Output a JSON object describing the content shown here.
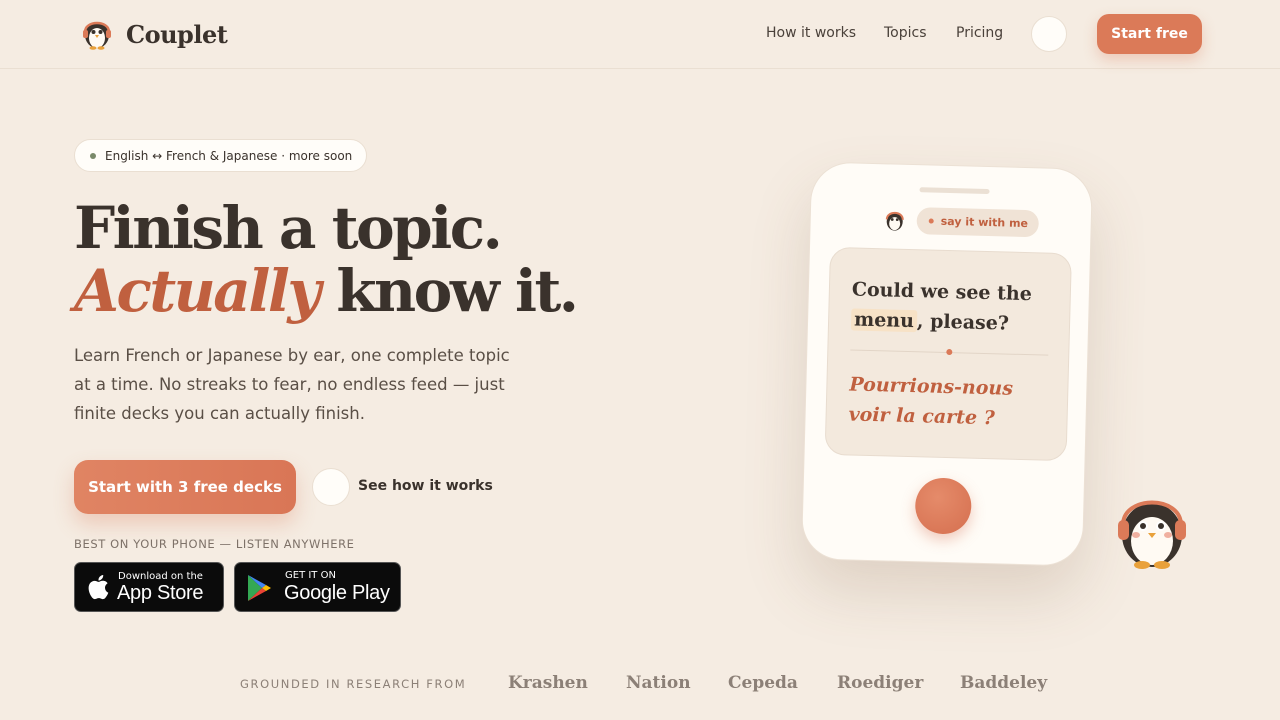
{
  "nav": {
    "brand": "Couplet",
    "links": [
      "How it works",
      "Topics",
      "Pricing"
    ],
    "cta": "Start free"
  },
  "hero": {
    "badge": "English ↔ French & Japanese · more soon",
    "title_line1": "Finish a topic.",
    "title_accent": "Actually",
    "title_line2_rest": " know it.",
    "lead": "Learn French or Japanese by ear, one complete topic at a time. No streaks to fear, no endless feed — just finite decks you can actually finish.",
    "cta_primary": "Start with 3 free decks",
    "cta_secondary": "See how it works",
    "phone_label": "BEST ON YOUR PHONE — LISTEN ANYWHERE"
  },
  "stores": {
    "apple_small": "Download on the",
    "apple_big": "App Store",
    "google_small": "GET IT ON",
    "google_big": "Google Play"
  },
  "phone": {
    "pill": "say it with me",
    "english_before": "Could we see the ",
    "english_highlight": "menu",
    "english_after": ", please?",
    "french": "Pourrions-nous voir la carte ?"
  },
  "research": {
    "label": "GROUNDED IN RESEARCH FROM",
    "names": [
      "Krashen",
      "Nation",
      "Cepeda",
      "Roediger",
      "Baddeley"
    ]
  },
  "colors": {
    "accent": "#db7a58",
    "accent_text": "#c0603f",
    "background": "#f5ece2",
    "ink": "#3a322c"
  }
}
